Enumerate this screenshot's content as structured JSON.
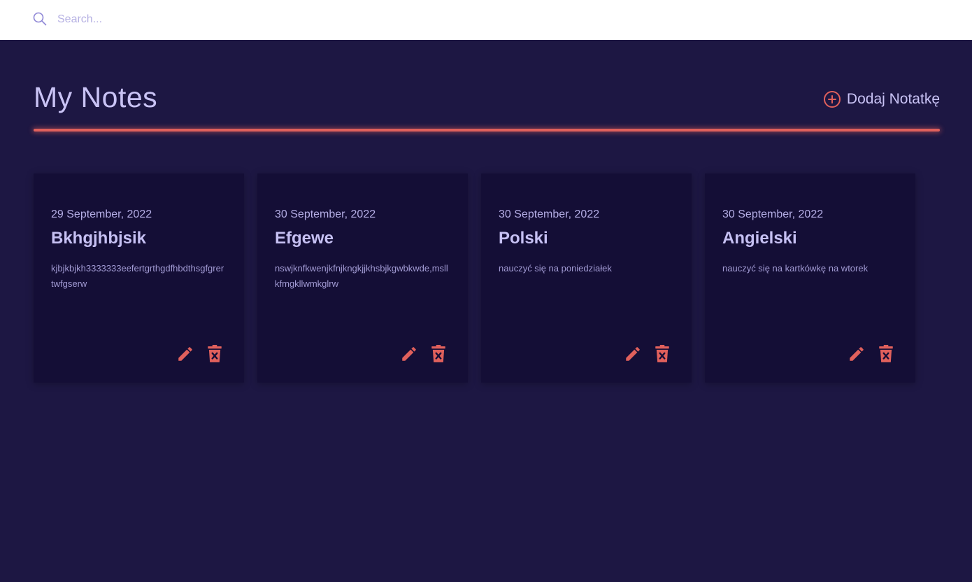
{
  "search": {
    "placeholder": "Search..."
  },
  "header": {
    "title": "My Notes",
    "add_label": "Dodaj Notatkę"
  },
  "colors": {
    "accent": "#e0605c",
    "background": "#1d1743",
    "card": "#140e36",
    "text": "#c9c3f5"
  },
  "icons": [
    "search-icon",
    "add-circle-icon",
    "edit-pencil-icon",
    "delete-trash-icon"
  ],
  "notes": [
    {
      "date": "29 September, 2022",
      "title": "Bkhgjhbjsik",
      "body": "kjbjkbjkh3333333eefertgrthgdfhbdthsgfgrertwfgserw"
    },
    {
      "date": "30 September, 2022",
      "title": "Efgewe",
      "body": "nswjknfkwenjkfnjkngkjjkhsbjkgwbkwde,msllkfmgkllwmkglrw"
    },
    {
      "date": "30 September, 2022",
      "title": "Polski",
      "body": "nauczyć się na poniedziałek"
    },
    {
      "date": "30 September, 2022",
      "title": "Angielski",
      "body": "nauczyć się na kartkówkę na wtorek"
    }
  ]
}
